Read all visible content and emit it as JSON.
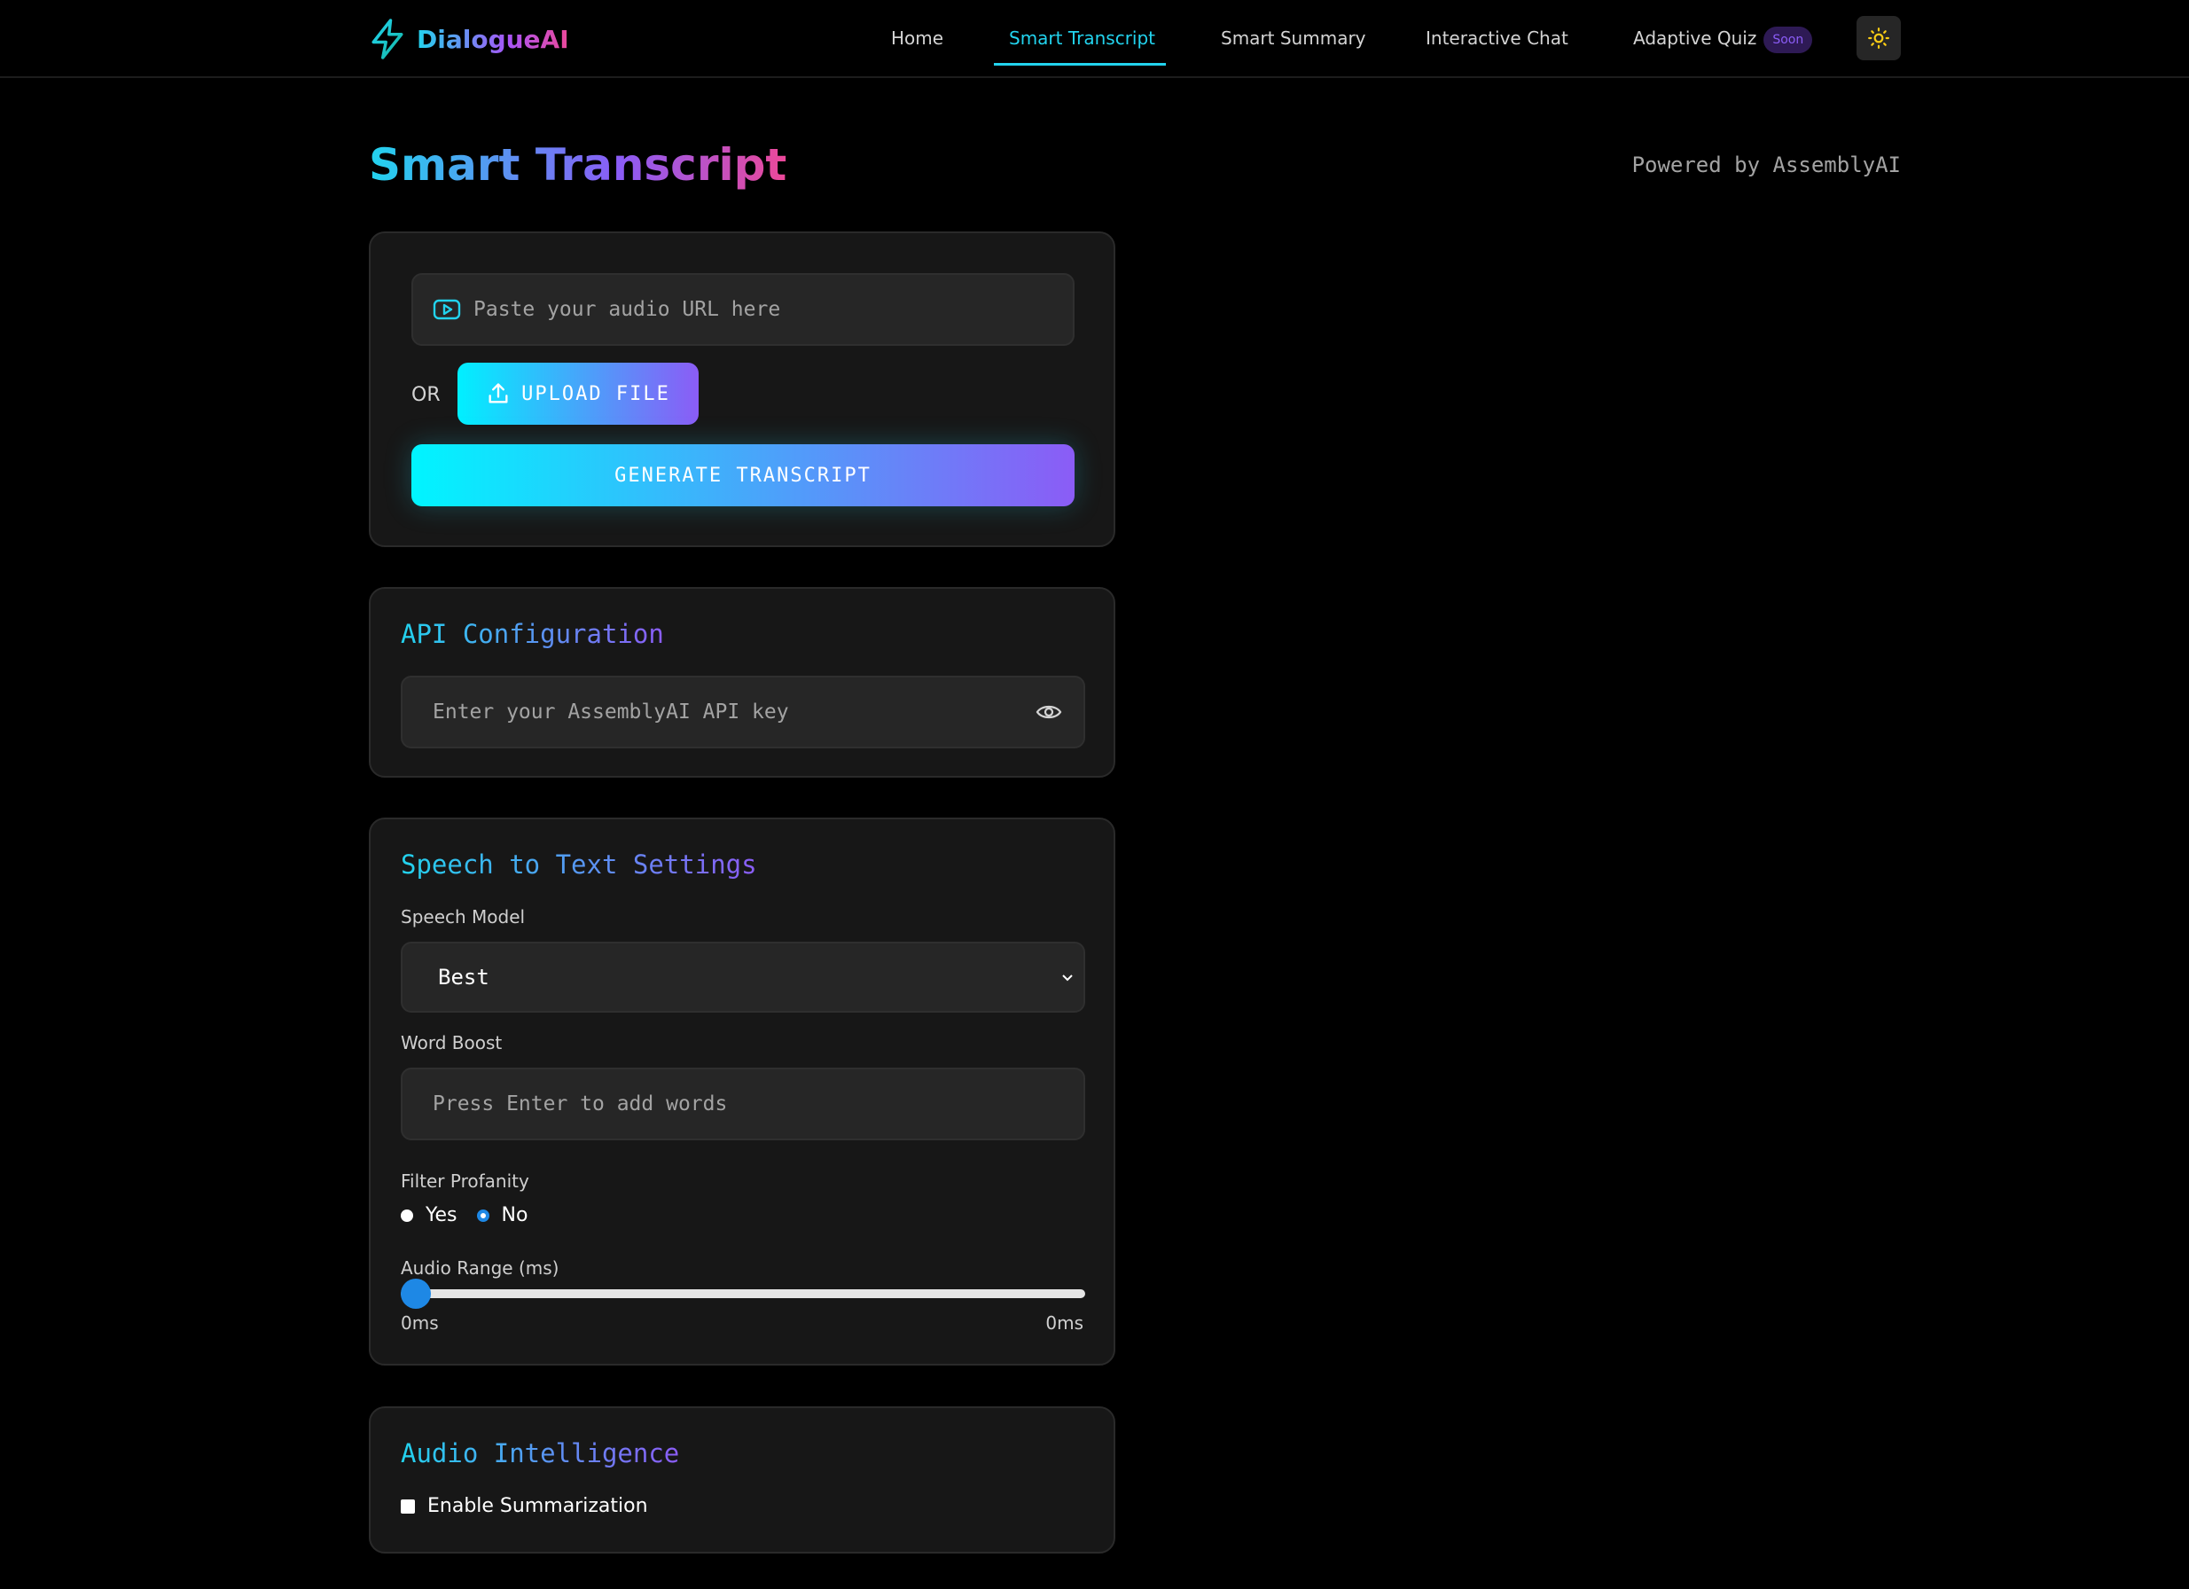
{
  "nav": {
    "brand": "DialogueAI",
    "links": [
      "Home",
      "Smart Transcript",
      "Smart Summary",
      "Interactive Chat",
      "Adaptive Quiz"
    ],
    "active": "Smart Transcript",
    "badge": "Soon"
  },
  "header": {
    "title": "Smart Transcript",
    "powered_by": "Powered by AssemblyAI"
  },
  "input_card": {
    "url_placeholder": "Paste your audio URL here",
    "or_label": "OR",
    "upload_label": "UPLOAD FILE",
    "generate_label": "GENERATE TRANSCRIPT"
  },
  "api_card": {
    "title": "API Configuration",
    "key_placeholder": "Enter your AssemblyAI API key"
  },
  "settings_card": {
    "title": "Speech to Text Settings",
    "speech_model_label": "Speech Model",
    "speech_model_value": "Best",
    "word_boost_label": "Word Boost",
    "word_boost_placeholder": "Press Enter to add words",
    "filter_profanity_label": "Filter Profanity",
    "filter_options": [
      "Yes",
      "No"
    ],
    "filter_selected": "No",
    "audio_range_label": "Audio Range (ms)",
    "range_min": "0ms",
    "range_max": "0ms",
    "range_fraction": 0
  },
  "intelligence_card": {
    "title": "Audio Intelligence",
    "summarization_label": "Enable Summarization",
    "summarization_checked": false
  },
  "colors": {
    "accent_cyan": "#22d3ee",
    "accent_purple": "#8b5cf6",
    "accent_pink": "#ec4899",
    "slider_blue": "#1e88e5"
  },
  "icons": {
    "logo": "lightning-icon",
    "theme": "sun-icon",
    "url": "play-icon",
    "upload": "upload-icon",
    "visibility": "eye-icon",
    "dropdown": "chevron-down-icon"
  }
}
